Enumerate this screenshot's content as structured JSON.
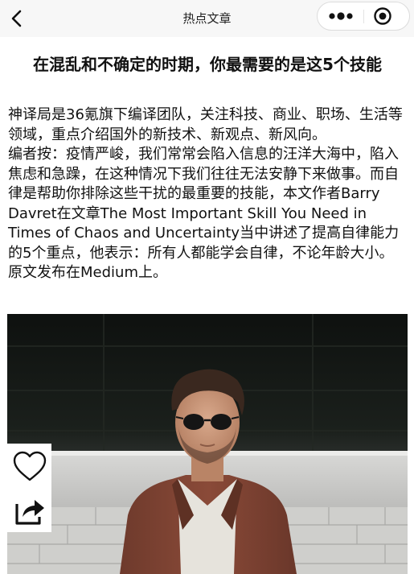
{
  "nav": {
    "title": "热点文章",
    "back_icon": "chevron-left-icon",
    "more_icon": "more-dots-icon",
    "close_icon": "target-close-icon"
  },
  "article": {
    "title": "在混乱和不确定的时期，你最需要的是这5个技能",
    "intro": "神译局是36氪旗下编译团队，关注科技、商业、职场、生活等领域，重点介绍国外的新技术、新观点、新风向。",
    "editor_note": "编者按：疫情严峻，我们常常会陷入信息的汪洋大海中，陷入焦虑和急躁，在这种情况下我们往往无法安静下来做事。而自律是帮助你排除这些干扰的最重要的技能，本文作者Barry Davret在文章The Most Important Skill You Need in Times of Chaos and Uncertainty当中讲述了提高自律能力的5个重点，他表示：所有人都能学会自律，不论年龄大小。原文发布在Medium上。"
  },
  "hero_image": {
    "subject": "man-with-sunglasses-photo"
  },
  "actions": {
    "like_icon": "heart-outline-icon",
    "share_icon": "share-arrow-icon"
  },
  "colors": {
    "nav_background": "#f7f7f7",
    "text": "#111111",
    "capsule_border": "#dcdcdc"
  }
}
